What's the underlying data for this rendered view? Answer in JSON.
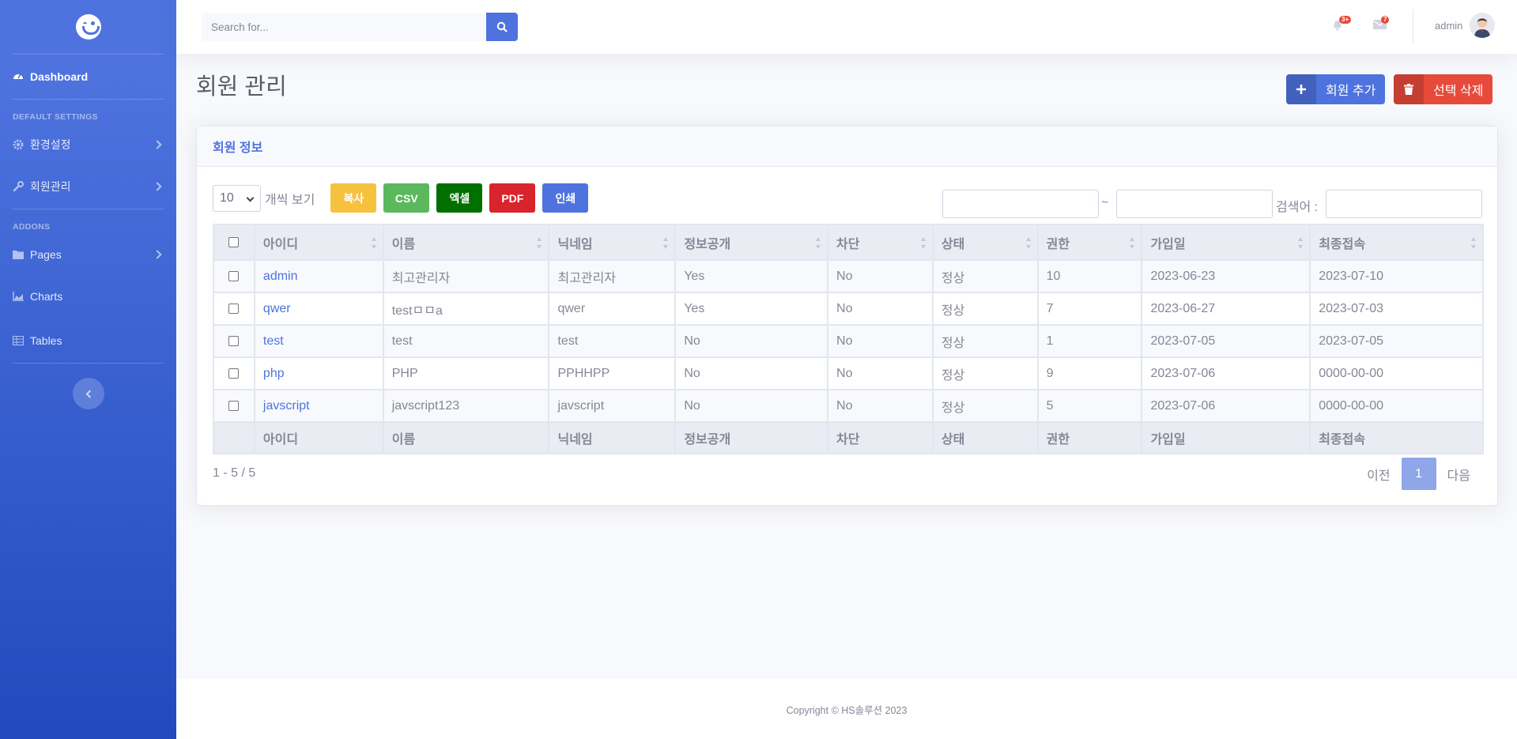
{
  "sidebar": {
    "brand_icon": "winking-face-icon",
    "dashboard_label": "Dashboard",
    "heading_default": "DEFAULT SETTINGS",
    "settings_label": "환경설정",
    "members_label": "회원관리",
    "heading_addons": "ADDONS",
    "pages_label": "Pages",
    "charts_label": "Charts",
    "tables_label": "Tables"
  },
  "topbar": {
    "search_placeholder": "Search for...",
    "alerts_badge": "3+",
    "messages_badge": "7",
    "user_name": "admin"
  },
  "page": {
    "title": "회원 관리",
    "add_button": "회원 추가",
    "delete_button": "선택 삭제"
  },
  "card": {
    "header": "회원 정보",
    "page_length": "10",
    "page_length_label": "개씩 보기",
    "export_buttons": [
      {
        "label": "복사",
        "color": "#f6c23e"
      },
      {
        "label": "CSV",
        "color": "#5cb85c"
      },
      {
        "label": "엑셀",
        "color": "#007000"
      },
      {
        "label": "PDF",
        "color": "#d9232d"
      },
      {
        "label": "인쇄",
        "color": "#4e73df"
      }
    ],
    "range_separator": "~",
    "search_label": "검색어 :",
    "columns": [
      "아이디",
      "이름",
      "닉네임",
      "정보공개",
      "차단",
      "상태",
      "권한",
      "가입일",
      "최종접속"
    ],
    "rows": [
      [
        "admin",
        "최고관리자",
        "최고관리자",
        "Yes",
        "No",
        "정상",
        "10",
        "2023-06-23",
        "2023-07-10"
      ],
      [
        "qwer",
        "testㅁㅁa",
        "qwer",
        "Yes",
        "No",
        "정상",
        "7",
        "2023-06-27",
        "2023-07-03"
      ],
      [
        "test",
        "test",
        "test",
        "No",
        "No",
        "정상",
        "1",
        "2023-07-05",
        "2023-07-05"
      ],
      [
        "php",
        "PHP",
        "PPHHPP",
        "No",
        "No",
        "정상",
        "9",
        "2023-07-06",
        "0000-00-00"
      ],
      [
        "javscript",
        "javscript123",
        "javscript",
        "No",
        "No",
        "정상",
        "5",
        "2023-07-06",
        "0000-00-00"
      ]
    ],
    "info": "1 - 5 / 5",
    "prev": "이전",
    "current_page": "1",
    "next": "다음"
  },
  "footer": {
    "copyright": "Copyright © HS솔루션 2023"
  }
}
